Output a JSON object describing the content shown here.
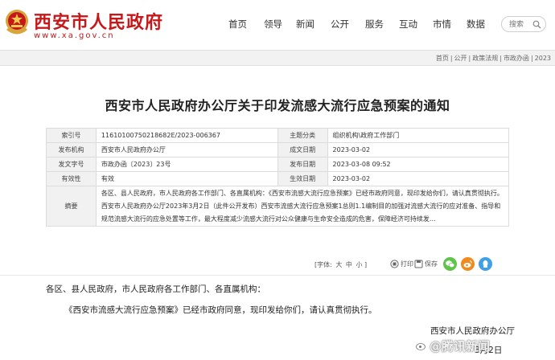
{
  "header": {
    "site_name": "西安市人民政府",
    "site_url": "www.xa.gov.cn",
    "nav": [
      "首页",
      "领导",
      "新闻",
      "公开",
      "服务",
      "互动",
      "市情",
      "数据"
    ],
    "search_placeholder": "搜索"
  },
  "breadcrumb": [
    "首页",
    "公开",
    "政策法规",
    "市政办函",
    "2023"
  ],
  "title": "西安市人民政府办公厅关于印发流感大流行应急预案的通知",
  "info": {
    "index_label": "索引号",
    "index_value": "11610100750218682E/2023-006367",
    "topic_label": "主题分类",
    "topic_value": "组织机构\\政府工作部门",
    "issuer_label": "发布机构",
    "issuer_value": "西安市人民政府办公厅",
    "written_label": "成文日期",
    "written_value": "2023-03-02",
    "docno_label": "发文字号",
    "docno_value": "市政办函〔2023〕23号",
    "pubdate_label": "发布日期",
    "pubdate_value": "2023-03-08 09:52",
    "validity_label": "有效性",
    "validity_value": "有效",
    "effective_label": "生效日期",
    "effective_value": "2023-03-02",
    "abstract_label": "摘要",
    "abstract_value": "各区、县人民政府，市人民政府各工作部门、各直属机构：《西安市流感大流行应急预案》已经市政府同意，现印发给你们，请认真贯彻执行。西安市人民政府办公厅2023年3月2日（此件公开发布）西安市流感大流行应急预案1总则1.1编制目的加强对流感大流行的应对准备、指导和规范流感大流行的应急处置等工作，最大程度减少流感大流行对公众健康与生命安全造成的危害，保障经济可持续发..."
  },
  "toolbar": {
    "font_label": "[字体:",
    "font_options": [
      "大",
      "中",
      "小"
    ],
    "font_close": "]",
    "print_label": "打印",
    "save_label": "保存"
  },
  "body": {
    "salutation": "各区、县人民政府，市人民政府各工作部门、各直属机构：",
    "para1": "《西安市流感大流行应急预案》已经市政府同意，现印发给你们，请认真贯彻执行。",
    "signature": "西安市人民政府办公厅",
    "date": "3月2日",
    "watermark": "@腾讯新闻"
  },
  "colors": {
    "brand_red": "#c4181b",
    "wechat_green": "#5ec44a",
    "weibo_orange": "#f08a1e",
    "qzone_blue": "#3fa0e6"
  }
}
